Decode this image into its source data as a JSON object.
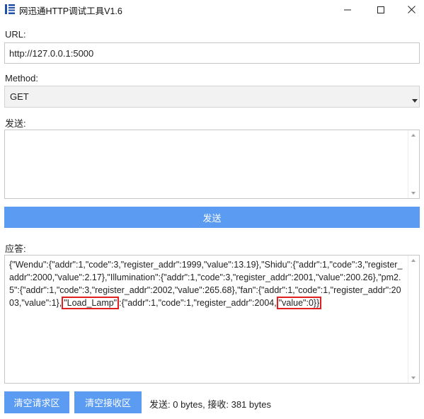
{
  "window": {
    "title": "网迅通HTTP调试工具V1.6",
    "app_icon": "app-logo-icon",
    "controls": [
      "minimize-icon",
      "maximize-icon",
      "close-icon"
    ]
  },
  "url": {
    "label": "URL:",
    "value": "http://127.0.0.1:5000"
  },
  "method": {
    "label": "Method:",
    "selected": "GET"
  },
  "send": {
    "label": "发送:",
    "value": "",
    "button_label": "发送"
  },
  "response": {
    "label": "应答:",
    "text_before_highlight_1": "{\"Wendu\":{\"addr\":1,\"code\":3,\"register_addr\":1999,\"value\":13.19},\"Shidu\":{\"addr\":1,\"code\":3,\"register_addr\":2000,\"value\":2.17},\"Illumination\":{\"addr\":1,\"code\":3,\"register_addr\":2001,\"value\":200.26},\"pm2.5\":{\"addr\":1,\"code\":3,\"register_addr\":2002,\"value\":265.68},\"fan\":{\"addr\":1,\"code\":1,\"register_addr\":2003,\"value\":1},",
    "highlight_1": "\"Load_Lamp\"",
    "text_between": ":{\"addr\":1,\"code\":1,\"register_addr\":2004,",
    "highlight_2": "\"value\":0}}"
  },
  "footer": {
    "clear_request_label": "清空请求区",
    "clear_response_label": "清空接收区",
    "status": "发送: 0 bytes, 接收: 381 bytes"
  },
  "colors": {
    "button_bg": "#5b9cf2",
    "highlight_border": "#e02020",
    "select_bg": "#f2f2f2"
  }
}
